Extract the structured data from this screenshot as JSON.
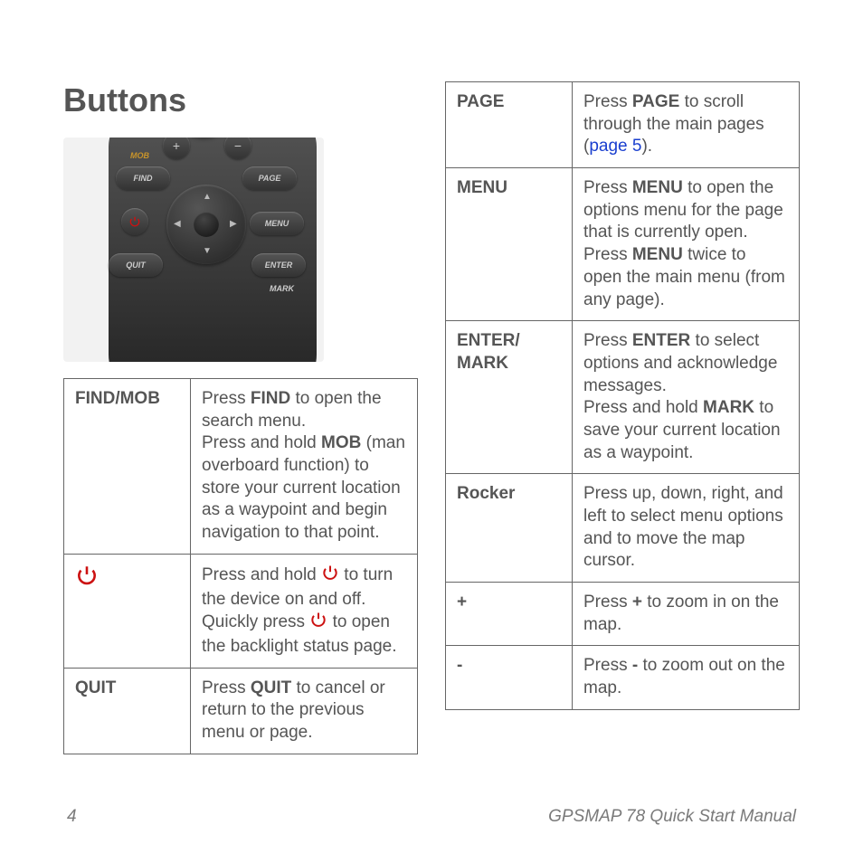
{
  "heading": "Buttons",
  "device": {
    "mob_label": "MOB",
    "find": "FIND",
    "page": "PAGE",
    "menu": "MENU",
    "quit": "QUIT",
    "enter": "ENTER",
    "mark_label": "MARK",
    "plus": "+",
    "minus": "−"
  },
  "left_rows": [
    {
      "label": "FIND/MOB",
      "parts": [
        {
          "t": "Press "
        },
        {
          "t": "FIND",
          "b": true
        },
        {
          "t": " to open the search menu."
        },
        {
          "br": true
        },
        {
          "t": "Press and hold "
        },
        {
          "t": "MOB",
          "b": true
        },
        {
          "t": " (man overboard function) to store your current location as a waypoint and begin navigation to that point."
        }
      ]
    },
    {
      "label": "__POWER__",
      "parts": [
        {
          "t": "Press and hold "
        },
        {
          "icon": "power"
        },
        {
          "t": " to turn the device on and off."
        },
        {
          "br": true
        },
        {
          "t": "Quickly press "
        },
        {
          "icon": "power"
        },
        {
          "t": " to open the backlight status page."
        }
      ]
    },
    {
      "label": "QUIT",
      "parts": [
        {
          "t": "Press "
        },
        {
          "t": "QUIT",
          "b": true
        },
        {
          "t": " to cancel or return to the previous menu or page."
        }
      ]
    }
  ],
  "right_rows": [
    {
      "label": "PAGE",
      "parts": [
        {
          "t": "Press "
        },
        {
          "t": "PAGE",
          "b": true
        },
        {
          "t": " to scroll through the main pages ("
        },
        {
          "link": "page 5"
        },
        {
          "t": ")."
        }
      ]
    },
    {
      "label": "MENU",
      "parts": [
        {
          "t": "Press "
        },
        {
          "t": "MENU",
          "b": true
        },
        {
          "t": " to open the options menu for the page that is currently open."
        },
        {
          "br": true
        },
        {
          "t": "Press "
        },
        {
          "t": "MENU",
          "b": true
        },
        {
          "t": " twice to open the main menu (from any page)."
        }
      ]
    },
    {
      "label": "ENTER/\nMARK",
      "parts": [
        {
          "t": "Press "
        },
        {
          "t": "ENTER",
          "b": true
        },
        {
          "t": " to select options and acknowledge messages."
        },
        {
          "br": true
        },
        {
          "t": "Press and hold "
        },
        {
          "t": "MARK",
          "b": true
        },
        {
          "t": " to save your current location as a waypoint."
        }
      ]
    },
    {
      "label": "Rocker",
      "parts": [
        {
          "t": "Press up, down, right, and left to select menu options and to move the map cursor."
        }
      ]
    },
    {
      "label": "+",
      "parts": [
        {
          "t": "Press "
        },
        {
          "t": "+",
          "b": true
        },
        {
          "t": " to zoom in on the map."
        }
      ]
    },
    {
      "label": "-",
      "parts": [
        {
          "t": "Press "
        },
        {
          "t": "-",
          "b": true
        },
        {
          "t": " to zoom out on the map."
        }
      ]
    }
  ],
  "footer": {
    "pagenum": "4",
    "title": "GPSMAP 78 Quick Start Manual"
  }
}
